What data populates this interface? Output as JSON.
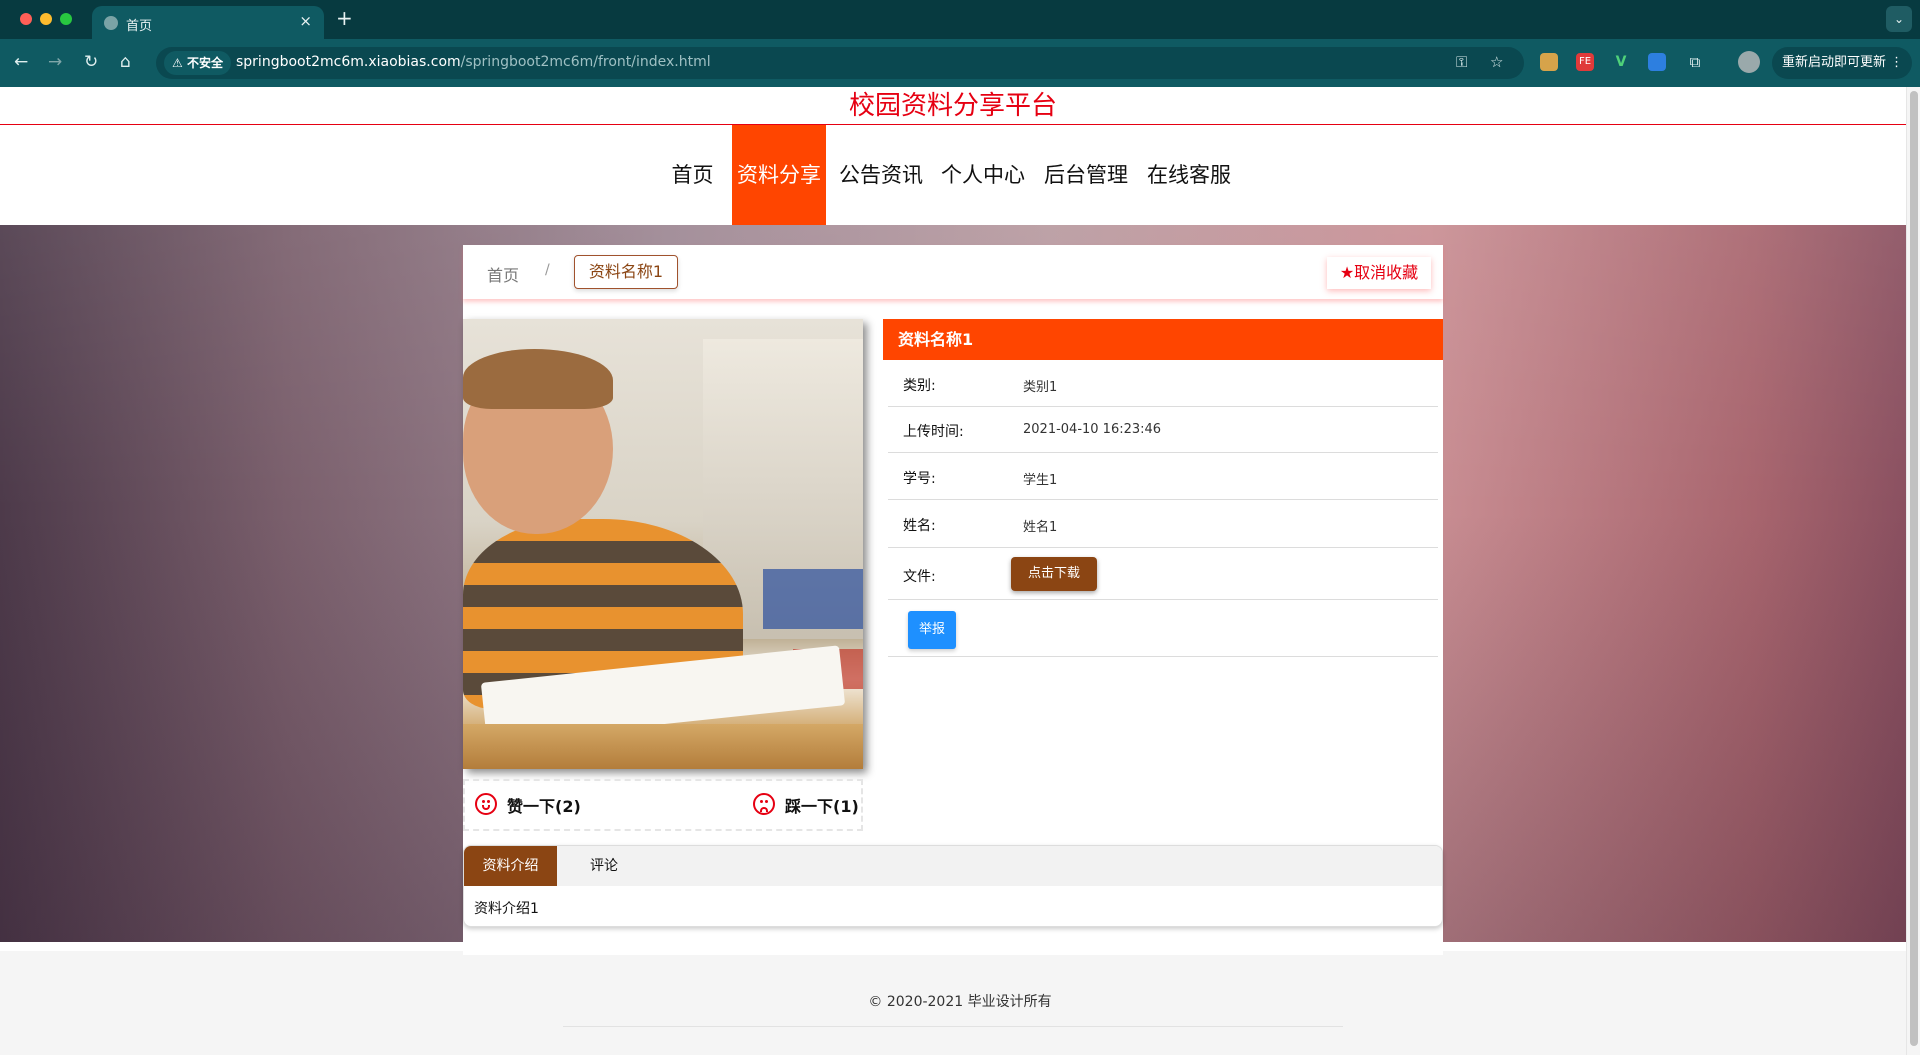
{
  "browser": {
    "tab_title": "首页",
    "tab_close": "×",
    "new_tab": "+",
    "tab_menu": "⌄",
    "back": "←",
    "forward": "→",
    "reload": "↻",
    "home": "⌂",
    "security_label": "不安全",
    "url_host": "springboot2mc6m.xiaobias.com",
    "url_path": "/springboot2mc6m/front/index.html",
    "update_label": "重新启动即可更新",
    "menu": "⋮",
    "extensions": [
      "FE",
      "V"
    ]
  },
  "site": {
    "title": "校园资料分享平台",
    "nav": [
      "首页",
      "资料分享",
      "公告资讯",
      "个人中心",
      "后台管理",
      "在线客服"
    ],
    "active_nav": "资料分享",
    "accent_color": "#ff4500",
    "title_color": "#e60012"
  },
  "breadcrumb": {
    "home": "首页",
    "separator": "/",
    "current": "资料名称1"
  },
  "favorite": {
    "icon": "★",
    "label": "取消收藏"
  },
  "votes": {
    "like": "赞一下(2)",
    "dislike": "踩一下(1)"
  },
  "detail": {
    "title": "资料名称1",
    "rows": [
      {
        "label": "类别:",
        "value": "类别1"
      },
      {
        "label": "上传时间:",
        "value": "2021-04-10 16:23:46"
      },
      {
        "label": "学号:",
        "value": "学生1"
      },
      {
        "label": "姓名:",
        "value": "姓名1"
      }
    ],
    "file_label": "文件:",
    "download_label": "点击下载",
    "report_label": "举报"
  },
  "tabs": {
    "items": [
      "资料介绍",
      "评论"
    ],
    "content": "资料介绍1"
  },
  "footer": {
    "copyright": "© 2020-2021 毕业设计所有"
  }
}
